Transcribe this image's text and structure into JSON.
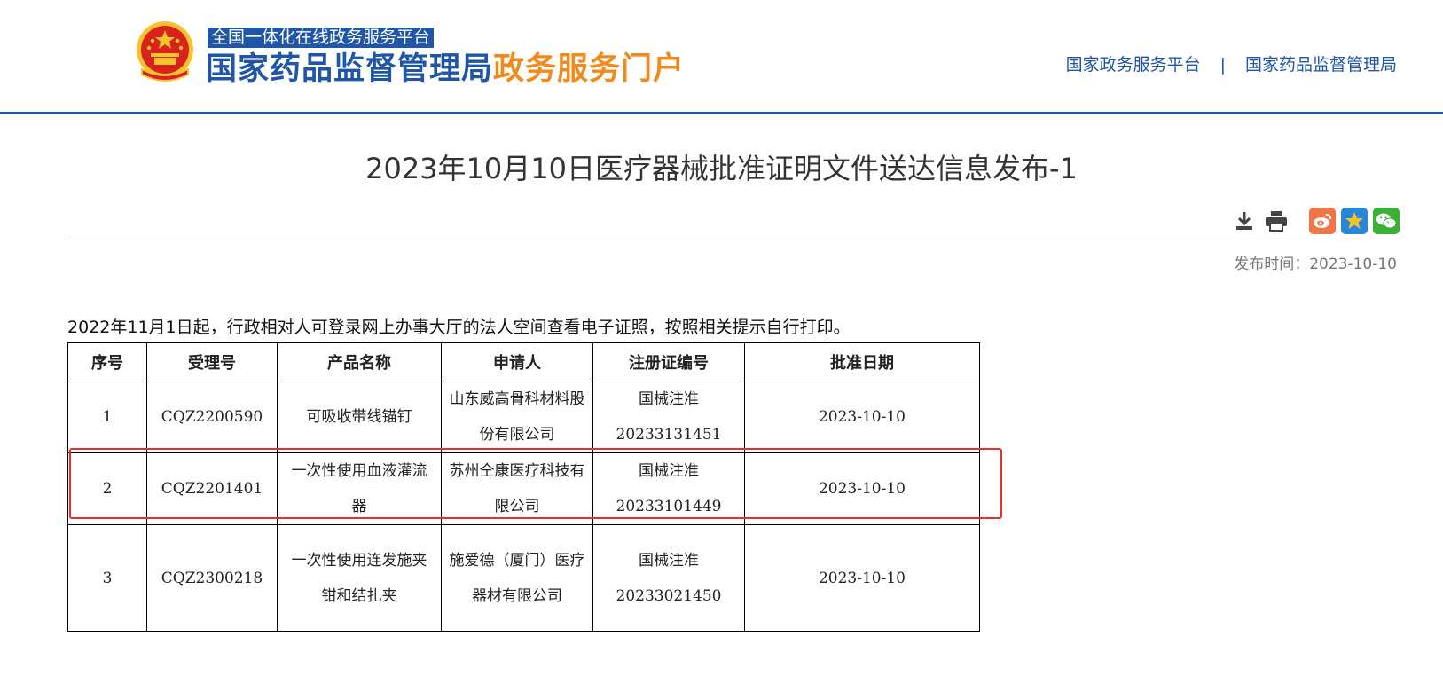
{
  "header": {
    "brand_top": "全国一体化在线政务服务平台",
    "brand_blue": "国家药品监督管理局",
    "brand_orange": "政务服务门户",
    "links": [
      "国家政务服务平台",
      "国家药品监督管理局"
    ],
    "separator": "|"
  },
  "article": {
    "title": "2023年10月10日医疗器械批准证明文件送达信息发布-1",
    "publish_time": "发布时间：2023-10-10",
    "notice": "2022年11月1日起，行政相对人可登录网上办事大厅的法人空间查看电子证照，按照相关提示自行打印。"
  },
  "table": {
    "headers": [
      "序号",
      "受理号",
      "产品名称",
      "申请人",
      "注册证编号",
      "批准日期"
    ],
    "rows": [
      [
        "1",
        "CQZ2200590",
        "可吸收带线锚钉",
        "山东威高骨科材料股份有限公司",
        "国械注准20233131451",
        "2023-10-10"
      ],
      [
        "2",
        "CQZ2201401",
        "一次性使用血液灌流器",
        "苏州仝康医疗科技有限公司",
        "国械注准20233101449",
        "2023-10-10"
      ],
      [
        "3",
        "CQZ2300218",
        "一次性使用连发施夹钳和结扎夹",
        "施爱德（厦门）医疗器材有限公司",
        "国械注准20233021450",
        "2023-10-10"
      ]
    ]
  },
  "colors": {
    "brand_blue": "#1f56a6",
    "brand_orange": "#f08a1c",
    "highlight_red": "#e2332a"
  },
  "icons": [
    "emblem-icon",
    "download-icon",
    "print-icon",
    "weibo-icon",
    "qzone-icon",
    "wechat-icon"
  ]
}
